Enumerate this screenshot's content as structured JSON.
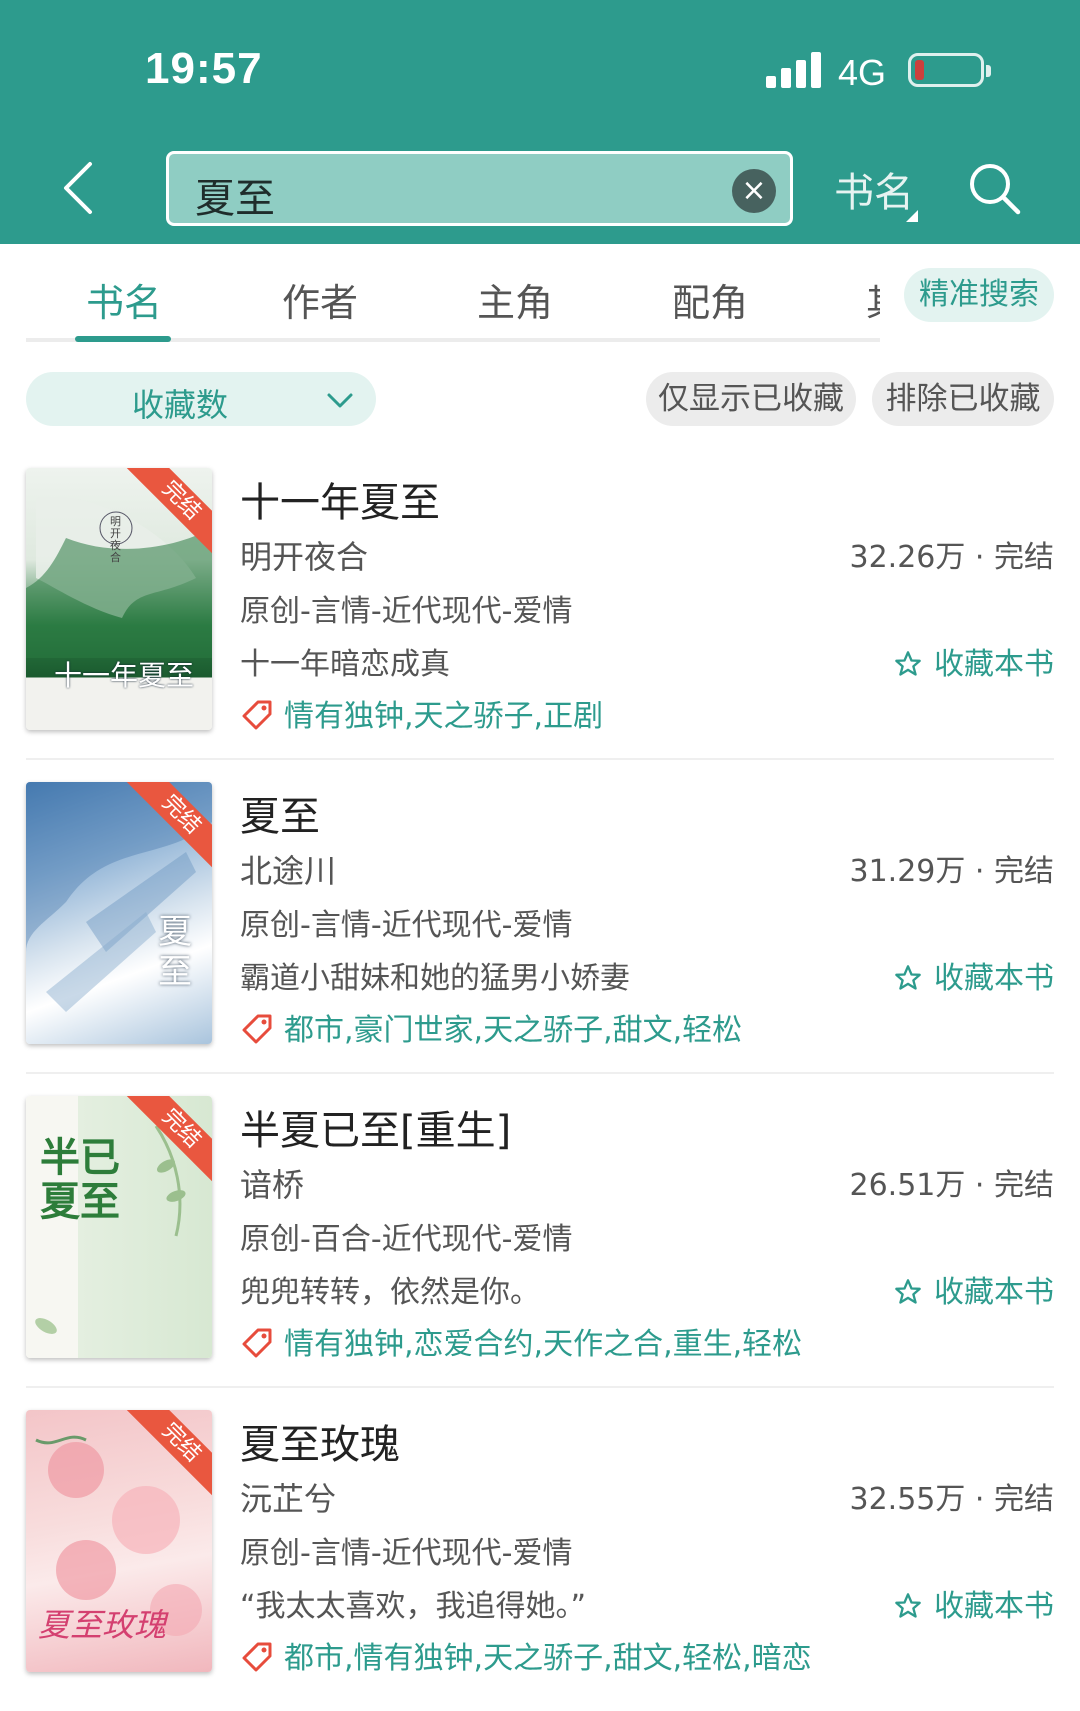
{
  "status_bar": {
    "time": "19:57",
    "network": "4G"
  },
  "search": {
    "query": "夏至",
    "clear_glyph": "×",
    "type": "书名"
  },
  "tabs": [
    {
      "label": "书名",
      "active": true
    },
    {
      "label": "作者",
      "active": false
    },
    {
      "label": "主角",
      "active": false
    },
    {
      "label": "配角",
      "active": false
    },
    {
      "label": "其",
      "active": false
    }
  ],
  "precise_search": "精准搜索",
  "sort": {
    "label": "收藏数"
  },
  "filters": {
    "only_saved": "仅显示已收藏",
    "exclude_saved": "排除已收藏"
  },
  "fav_label": "收藏本书",
  "colors": {
    "theme": "#2d9b8d",
    "ribbon": "#e9573f",
    "tag_icon": "#e74c3c"
  },
  "books": [
    {
      "title": "十一年夏至",
      "author": "明开夜合",
      "count": "32.26万 · 完结",
      "genre": "原创-言情-近代现代-爱情",
      "desc": "十一年暗恋成真",
      "tags": "情有独钟,天之骄子,正剧",
      "status_ribbon": "完结",
      "cover_text": "十一年夏至",
      "cover_seal": "明开夜合"
    },
    {
      "title": "夏至",
      "author": "北途川",
      "count": "31.29万 · 完结",
      "genre": "原创-言情-近代现代-爱情",
      "desc": "霸道小甜妹和她的猛男小娇妻",
      "tags": "都市,豪门世家,天之骄子,甜文,轻松",
      "status_ribbon": "完结",
      "cover_text": "夏至"
    },
    {
      "title": "半夏已至[重生]",
      "author": "谙桥",
      "count": "26.51万 · 完结",
      "genre": "原创-百合-近代现代-爱情",
      "desc": "兜兜转转，依然是你。",
      "tags": "情有独钟,恋爱合约,天作之合,重生,轻松",
      "status_ribbon": "完结",
      "cover_text": "半已夏至"
    },
    {
      "title": "夏至玫瑰",
      "author": "沅芷兮",
      "count": "32.55万 · 完结",
      "genre": "原创-言情-近代现代-爱情",
      "desc": "“我太太喜欢，我追得她。”",
      "tags": "都市,情有独钟,天之骄子,甜文,轻松,暗恋",
      "status_ribbon": "完结",
      "cover_text": "夏至玫瑰"
    }
  ]
}
